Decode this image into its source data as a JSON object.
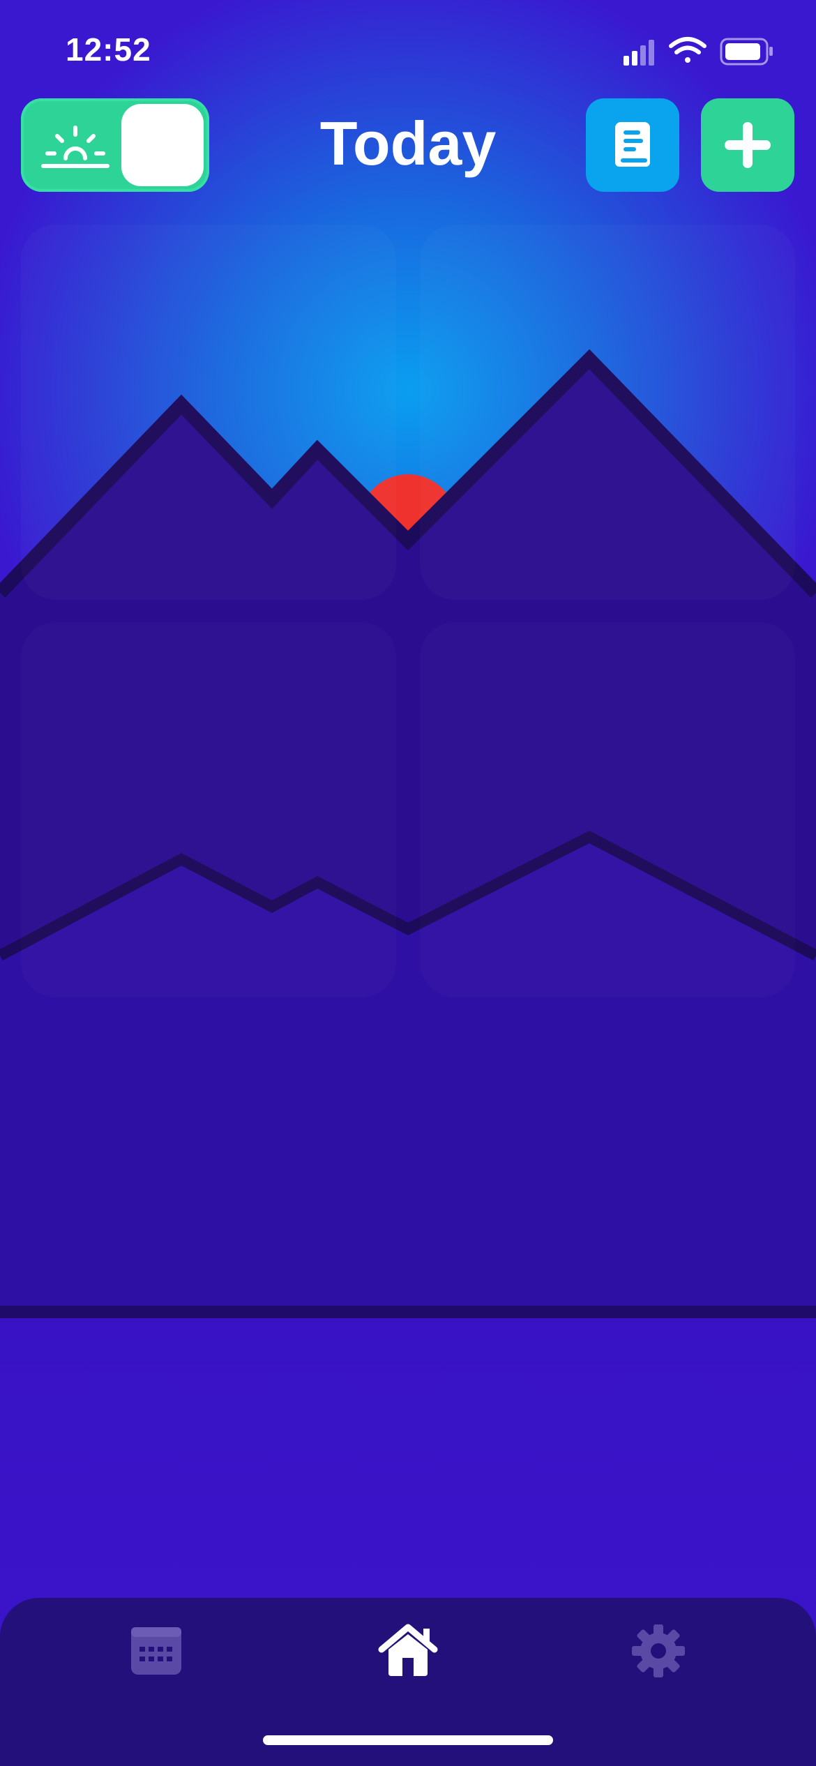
{
  "status_bar": {
    "time": "12:52"
  },
  "header": {
    "title": "Today"
  },
  "toggle": {
    "icon": "sunrise-icon",
    "state": "on"
  },
  "actions": {
    "book_icon": "journal-book-icon",
    "add_icon": "plus-icon"
  },
  "tabs": [
    {
      "icon": "calendar-icon",
      "active": false
    },
    {
      "icon": "home-icon",
      "active": true
    },
    {
      "icon": "gear-icon",
      "active": false
    }
  ],
  "colors": {
    "background": "#3a14c8",
    "sky_glow": "#0b8ee8",
    "sun": "#f0322e",
    "mountain": "#2a0e8f",
    "mountain_outline": "#1c0a5a",
    "accent_green": "#2ed397",
    "accent_blue": "#0aa3ee",
    "tabbar": "#23107a"
  }
}
